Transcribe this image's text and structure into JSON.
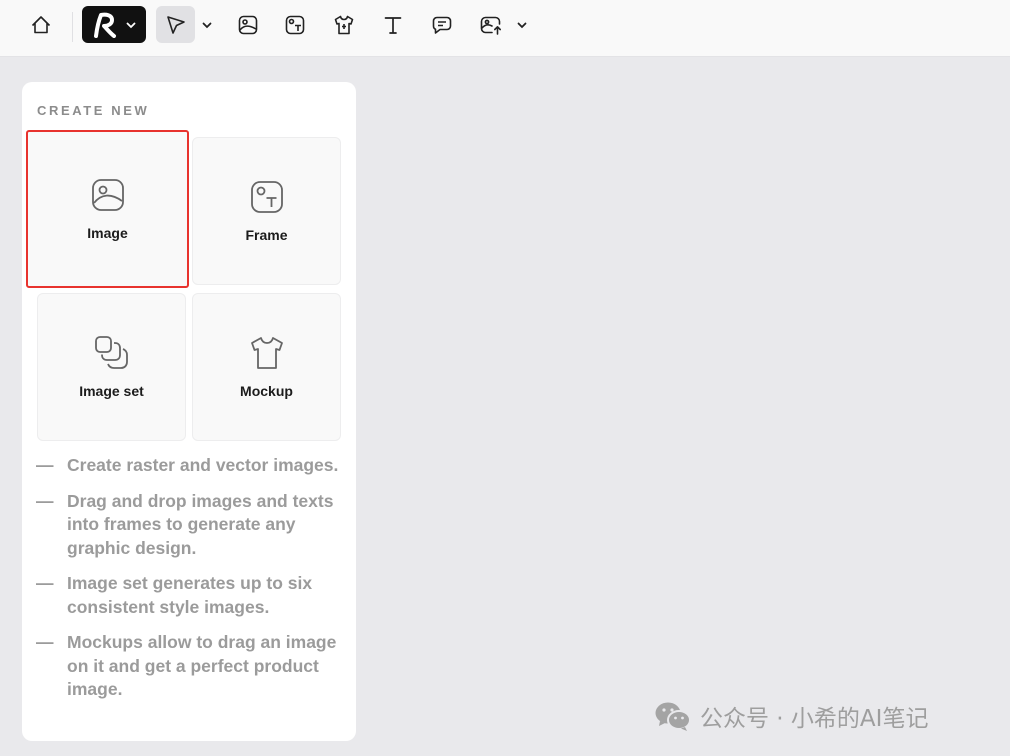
{
  "toolbar": {
    "items": [
      {
        "icon": "home-icon"
      },
      {
        "icon": "brand-logo-icon"
      },
      {
        "icon": "select-arrow-icon"
      },
      {
        "icon": "image-icon"
      },
      {
        "icon": "frame-icon"
      },
      {
        "icon": "mockup-shirt-icon"
      },
      {
        "icon": "text-icon"
      },
      {
        "icon": "comment-icon"
      },
      {
        "icon": "upload-image-icon"
      }
    ]
  },
  "panel": {
    "section_label": "CREATE NEW",
    "cards": [
      {
        "label": "Image",
        "icon": "image-icon",
        "selected": true
      },
      {
        "label": "Frame",
        "icon": "frame-icon",
        "selected": false
      },
      {
        "label": "Image set",
        "icon": "image-set-icon",
        "selected": false
      },
      {
        "label": "Mockup",
        "icon": "mockup-shirt-icon",
        "selected": false
      }
    ],
    "descriptions": [
      "Create raster and vector images.",
      "Drag and drop images and texts into frames to generate any graphic design.",
      "Image set generates up to six consistent style images.",
      "Mockups allow to drag an image on it and get a perfect product image."
    ]
  },
  "watermark": {
    "text": "公众号 · 小希的AI笔记"
  },
  "colors": {
    "selection": "#e8332e",
    "brand_button": "#111111",
    "canvas": "#e9e9ec"
  }
}
